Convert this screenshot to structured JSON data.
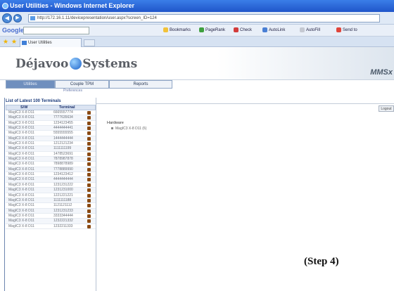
{
  "window": {
    "title": "User Utilities - Windows Internet Explorer"
  },
  "address": {
    "url": "http://172.16.1.11/devicepresentation/user.aspx?screen_ID=124"
  },
  "google_toolbar": {
    "logo": "Google",
    "items": [
      "Bookmarks",
      "PageRank",
      "Check",
      "AutoLink",
      "AutoFill",
      "Send to"
    ]
  },
  "browser_tabs": [
    {
      "label": "User Utilities"
    }
  ],
  "app": {
    "brand_left": "Déjavoo",
    "brand_right": "Systems",
    "product": "MMSx",
    "nav_tabs": [
      {
        "label": "Utilities"
      },
      {
        "label": "Couple TPM"
      },
      {
        "label": "Reports"
      }
    ],
    "preferences_label": "Preferences",
    "logout_label": "Logout"
  },
  "sidebar": {
    "title": "List of Latest 100 Terminals",
    "col_sw": "S/W",
    "col_terminal": "Terminal",
    "rows": [
      {
        "sw": "MagIC3 X-8 D11",
        "terminal": "6665557774"
      },
      {
        "sw": "MagIC3 X-8 D11",
        "terminal": "7777635634"
      },
      {
        "sw": "MagIC3 X-8 D11",
        "terminal": "1234123455"
      },
      {
        "sw": "MagIC3 X-8 D11",
        "terminal": "4444444441"
      },
      {
        "sw": "MagIC3 X-8 D11",
        "terminal": "5555555555"
      },
      {
        "sw": "MagIC3 X-8 D11",
        "terminal": "1444444444"
      },
      {
        "sw": "MagIC3 X-8 D11",
        "terminal": "1212121234"
      },
      {
        "sw": "MagIC3 X-8 D11",
        "terminal": "1111111199"
      },
      {
        "sw": "MagIC3 X-8 D11",
        "terminal": "1478523691"
      },
      {
        "sw": "MagIC3 X-8 D11",
        "terminal": "7878987878"
      },
      {
        "sw": "MagIC3 X-8 D11",
        "terminal": "7898878989"
      },
      {
        "sw": "MagIC3 X-8 D11",
        "terminal": "7778889990"
      },
      {
        "sw": "MagIC3 X-8 D11",
        "terminal": "1234123412"
      },
      {
        "sw": "MagIC3 X-8 D11",
        "terminal": "4444444444"
      },
      {
        "sw": "MagIC3 X-8 D11",
        "terminal": "1231231222"
      },
      {
        "sw": "MagIC3 X-8 D11",
        "terminal": "1231231000"
      },
      {
        "sw": "MagIC3 X-8 D11",
        "terminal": "1221221221"
      },
      {
        "sw": "MagIC3 X-8 D11",
        "terminal": "1111111188"
      },
      {
        "sw": "MagIC3 X-8 D11",
        "terminal": "1121121112"
      },
      {
        "sw": "MagIC3 X-8 D11",
        "terminal": "1231231233"
      },
      {
        "sw": "MagIC3 X-8 D11",
        "terminal": "3333344444"
      },
      {
        "sw": "MagIC3 X-8 D11",
        "terminal": "1232221332"
      },
      {
        "sw": "MagIC3 X-8 D11",
        "terminal": "1232211333"
      }
    ]
  },
  "content": {
    "hardware_label": "Hardware",
    "hardware_item": "MagIC3 X-8 D11 (6)"
  },
  "annotation": "(Step 4)"
}
